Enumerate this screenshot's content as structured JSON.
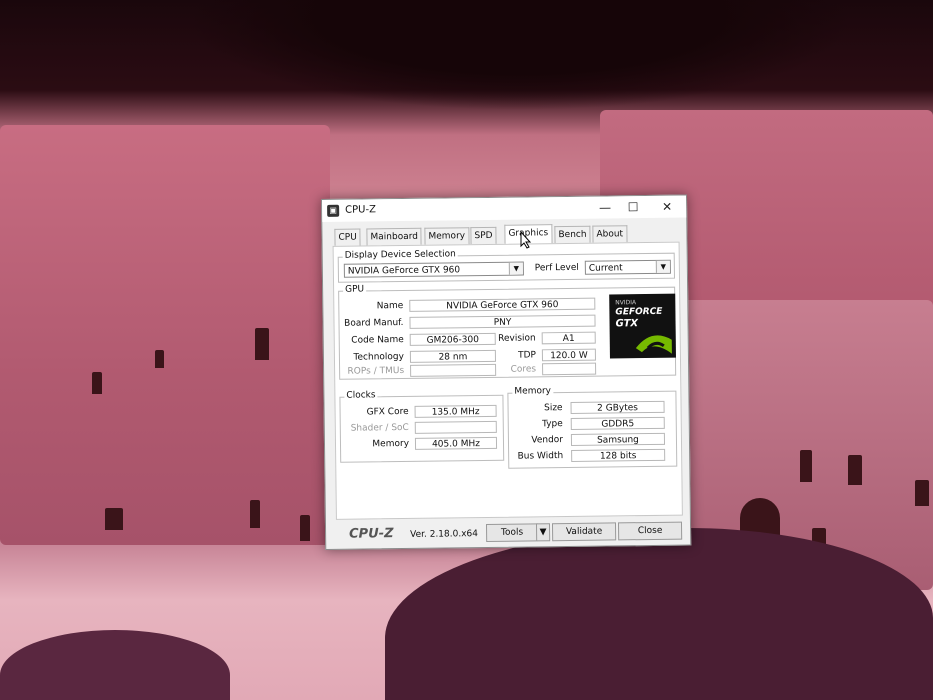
{
  "window": {
    "title": "CPU-Z",
    "icon": "cpuz-app-icon",
    "controls": {
      "minimize": "—",
      "maximize": "☐",
      "close": "✕"
    }
  },
  "tabs": [
    {
      "label": "CPU"
    },
    {
      "label": "Mainboard"
    },
    {
      "label": "Memory"
    },
    {
      "label": "SPD"
    },
    {
      "label": "Graphics"
    },
    {
      "label": "Bench"
    },
    {
      "label": "About"
    }
  ],
  "display": {
    "group_label": "Display Device Selection",
    "device": "NVIDIA GeForce GTX 960",
    "perf_label": "Perf Level",
    "perf_value": "Current"
  },
  "gpu": {
    "group_label": "GPU",
    "name_label": "Name",
    "name": "NVIDIA GeForce GTX 960",
    "board_label": "Board Manuf.",
    "board": "PNY",
    "code_label": "Code Name",
    "code": "GM206-300",
    "revision_label": "Revision",
    "revision": "A1",
    "tech_label": "Technology",
    "tech": "28 nm",
    "tdp_label": "TDP",
    "tdp": "120.0 W",
    "rops_label": "ROPs / TMUs",
    "rops": "",
    "cores_label": "Cores",
    "cores": ""
  },
  "logo": {
    "line1": "NVIDIA",
    "line2": "GEFORCE",
    "line3": "GTX"
  },
  "clocks": {
    "group_label": "Clocks",
    "gfx_label": "GFX Core",
    "gfx": "135.0 MHz",
    "shader_label": "Shader / SoC",
    "shader": "",
    "mem_label": "Memory",
    "mem": "405.0 MHz"
  },
  "memory": {
    "group_label": "Memory",
    "size_label": "Size",
    "size": "2 GBytes",
    "type_label": "Type",
    "type": "GDDR5",
    "vendor_label": "Vendor",
    "vendor": "Samsung",
    "bus_label": "Bus Width",
    "bus": "128 bits"
  },
  "footer": {
    "brand": "CPU-Z",
    "version": "Ver. 2.18.0.x64",
    "tools": "Tools",
    "validate": "Validate",
    "close": "Close"
  }
}
